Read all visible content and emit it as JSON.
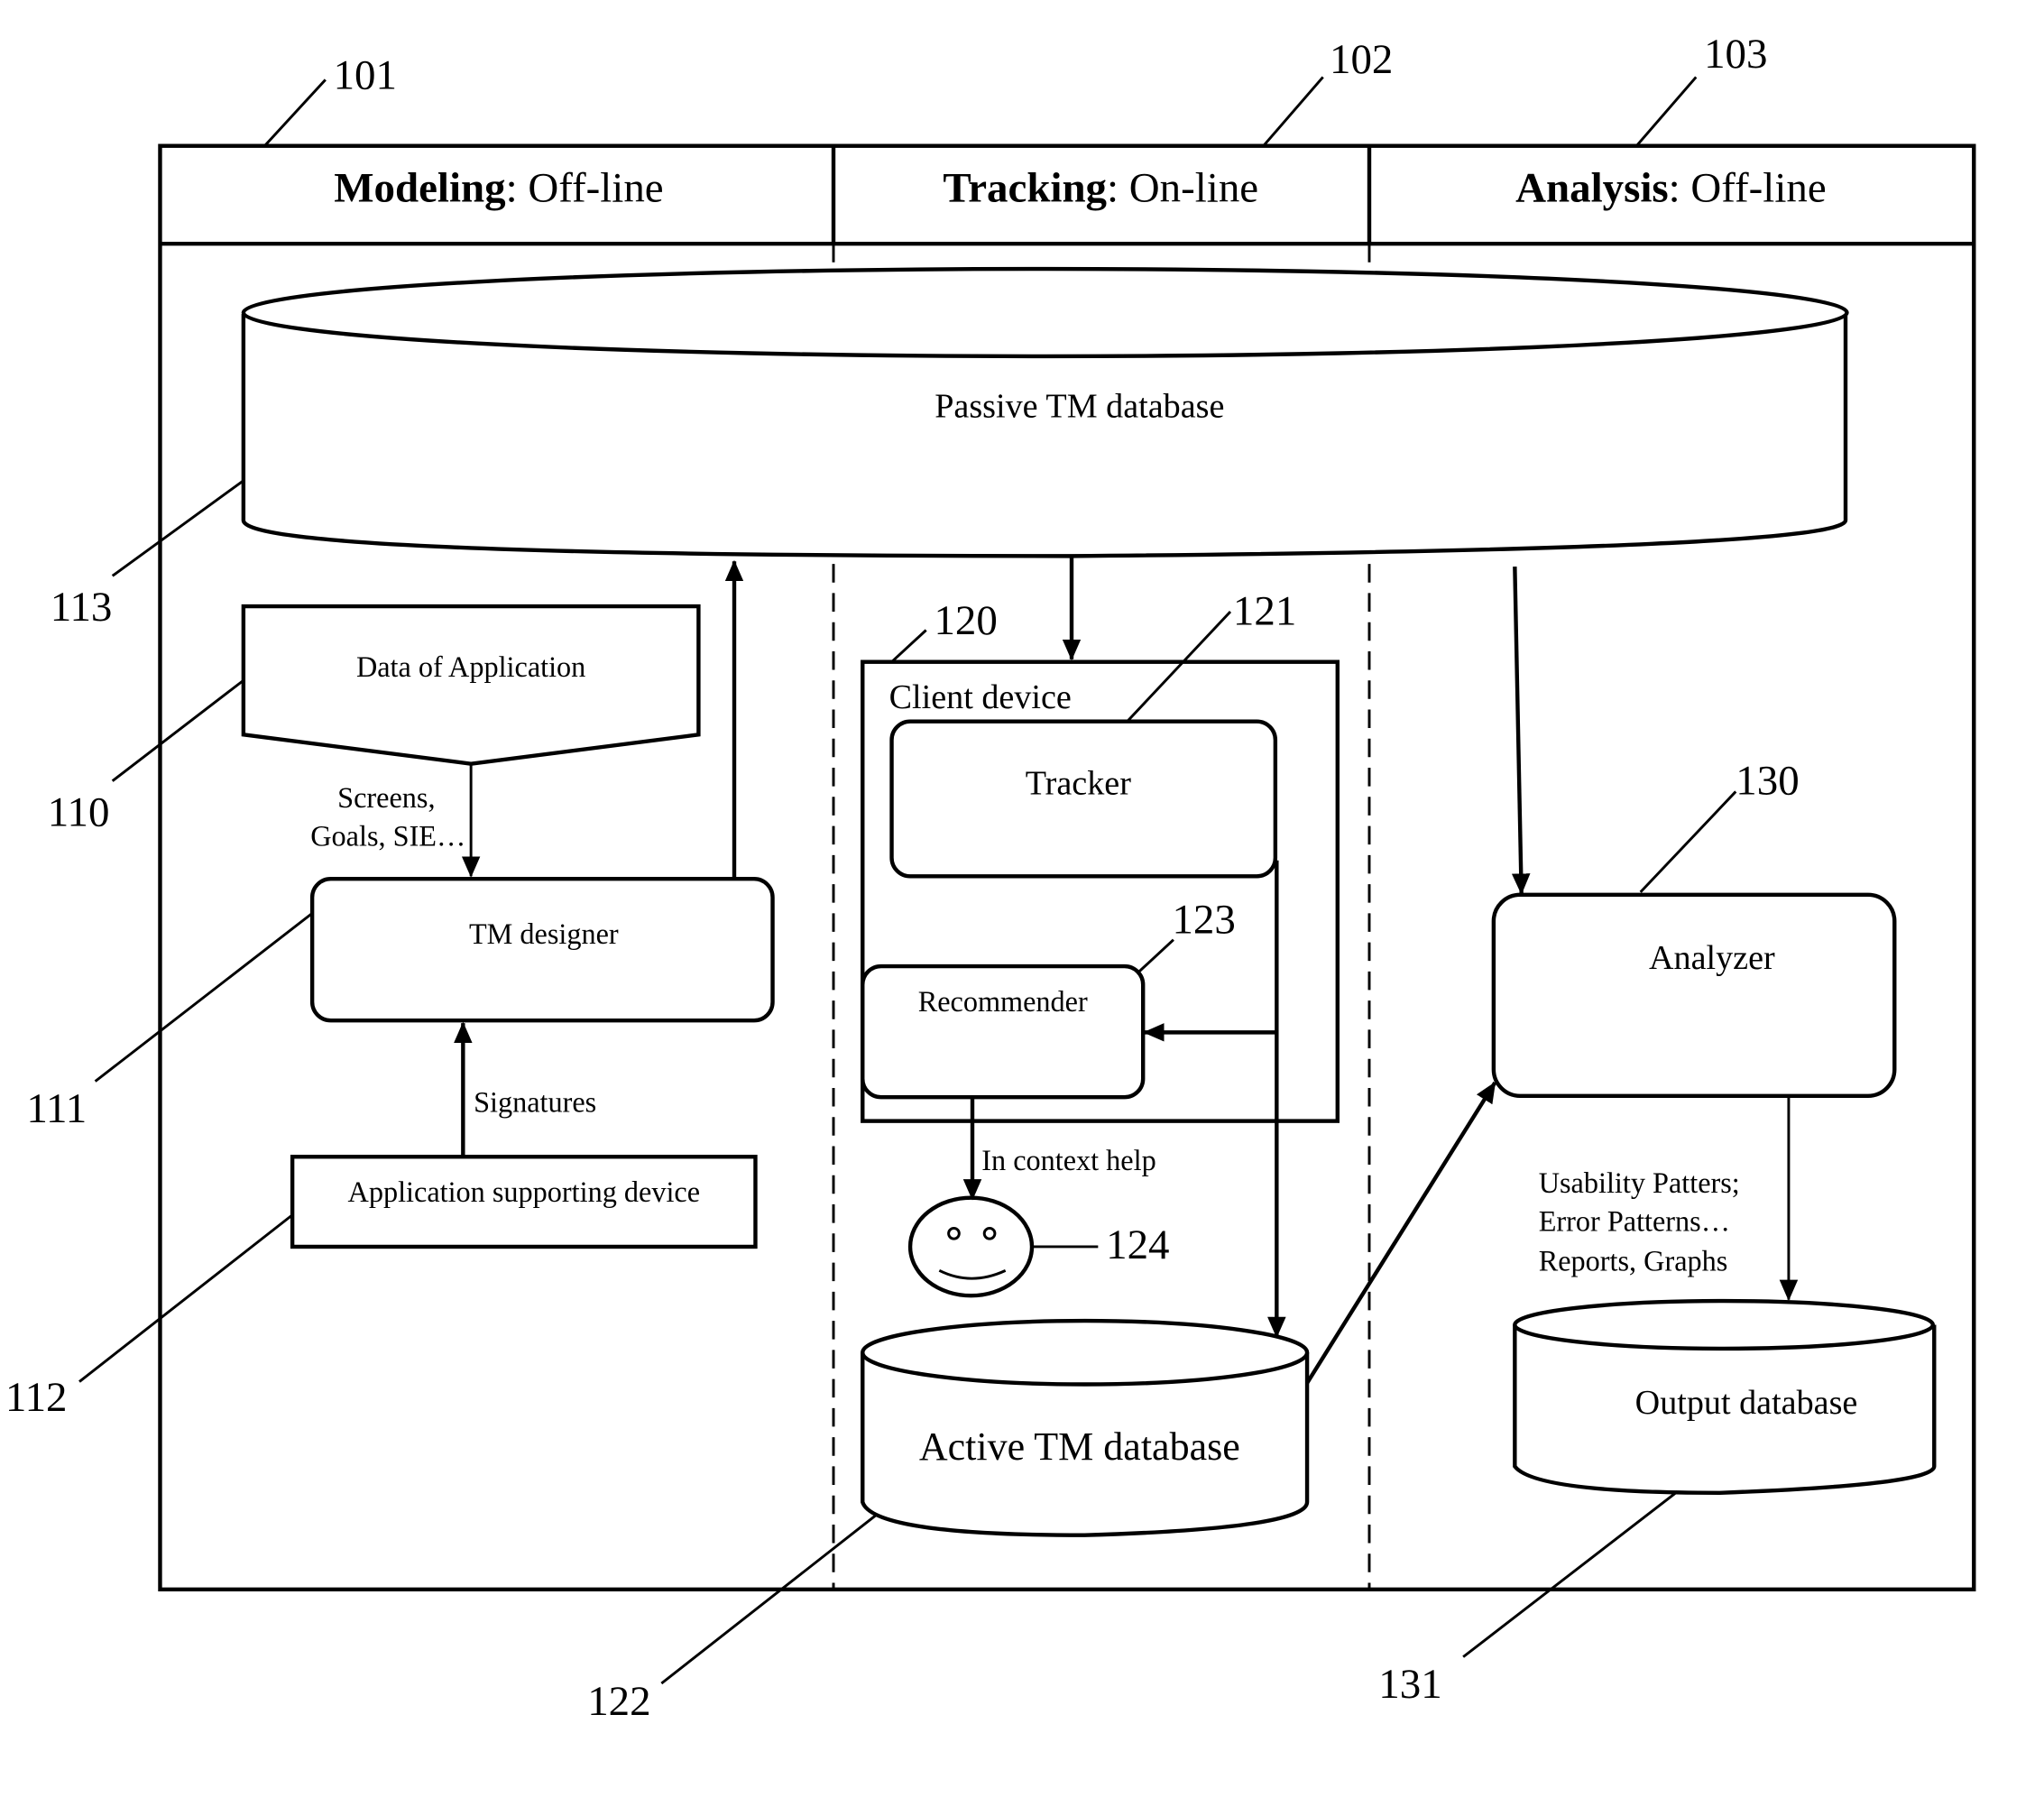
{
  "columns": [
    {
      "ref": "101",
      "title_bold": "Modeling",
      "title_rest": ": Off-line"
    },
    {
      "ref": "102",
      "title_bold": "Tracking",
      "title_rest": ": On-line"
    },
    {
      "ref": "103",
      "title_bold": "Analysis",
      "title_rest": ": Off-line"
    }
  ],
  "nodes": {
    "passive_db": {
      "ref": "113",
      "label": "Passive TM database"
    },
    "data_of_application": {
      "ref": "110",
      "label": "Data of Application"
    },
    "tm_designer": {
      "ref": "111",
      "label": "TM designer"
    },
    "app_supporting_device": {
      "ref": "112",
      "label": "Application supporting device"
    },
    "client_device": {
      "ref": "120",
      "label": "Client device"
    },
    "tracker": {
      "ref": "121",
      "label": "Tracker"
    },
    "recommender": {
      "ref": "123",
      "label": "Recommender"
    },
    "user": {
      "ref": "124"
    },
    "active_db": {
      "ref": "122",
      "label": "Active TM database"
    },
    "analyzer": {
      "ref": "130",
      "label": "Analyzer"
    },
    "output_db": {
      "ref": "131",
      "label": "Output database"
    }
  },
  "edge_labels": {
    "screens_line1": "Screens,",
    "screens_line2": "Goals, SIE…",
    "signatures": "Signatures",
    "in_context_help": "In context help",
    "analyzer_out_line1": "Usability Patters;",
    "analyzer_out_line2": "Error Patterns…",
    "analyzer_out_line3": "Reports, Graphs"
  }
}
